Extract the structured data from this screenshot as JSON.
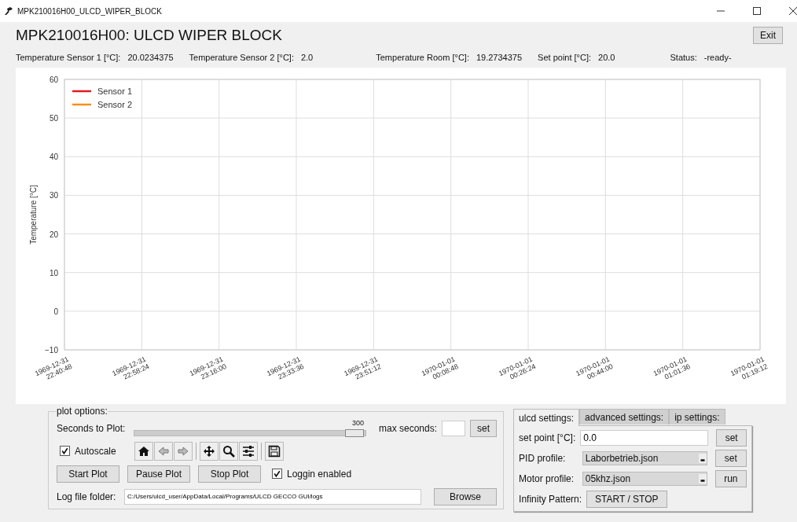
{
  "window": {
    "title": "MPK210016H00_ULCD_WIPER_BLOCK"
  },
  "header": {
    "title": "MPK210016H00: ULCD WIPER BLOCK",
    "exit_button": "Exit"
  },
  "readings": [
    {
      "label": "Temperature Sensor 1 [°C]:",
      "value": "20.0234375"
    },
    {
      "label": "Temperature Sensor 2 [°C]:",
      "value": "2.0"
    },
    {
      "label": "Temperature Room [°C]:",
      "value": "19.2734375"
    },
    {
      "label": "Set point [°C]:",
      "value": "20.0"
    },
    {
      "label": "Status:",
      "value": "-ready-"
    }
  ],
  "chart": {
    "chart_data": {
      "type": "line",
      "grid": true,
      "ylabel": "Temperature [°C]",
      "ylim": [
        -10,
        60
      ],
      "yticks": [
        {
          "value": -10,
          "label": "−10"
        },
        0,
        10,
        20,
        30,
        40,
        50,
        60
      ],
      "categories": [
        "1969-12-31 22:40:48",
        "1969-12-31 22:58:24",
        "1969-12-31 23:16:00",
        "1969-12-31 23:33:36",
        "1969-12-31 23:51:12",
        "1970-01-01 00:08:48",
        "1970-01-01 00:26:24",
        "1970-01-01 00:44:00",
        "1970-01-01 01:01:36",
        "1970-01-01 01:19:12"
      ],
      "series": [
        {
          "name": "Sensor 1",
          "color": "#e31a1c",
          "values": [
            null,
            null,
            null,
            null,
            null,
            null,
            null,
            null,
            null,
            null
          ]
        },
        {
          "name": "Sensor 2",
          "color": "#ff8c1a",
          "values": [
            null,
            null,
            null,
            null,
            null,
            null,
            null,
            null,
            null,
            null
          ]
        }
      ]
    }
  },
  "plot_options": {
    "title": "plot options:",
    "seconds_label": "Seconds to Plot:",
    "slider": {
      "level": 1.0,
      "reading": "300"
    },
    "max_seconds_label": "max seconds:",
    "set_button": "set",
    "autoscale": {
      "label": "Autoscale",
      "checked": true
    },
    "buttons": [
      "Start Plot",
      "Pause Plot",
      "Stop Plot"
    ],
    "logging": {
      "label": "Loggin enabled",
      "checked": true
    },
    "log_folder_label": "Log file folder:",
    "log_folder_value": "C:/Users/ulcd_user/AppData/Local/Programs/ULCD GECCO GUI/logs",
    "browse_button": "Browse"
  },
  "settings": {
    "tabs": [
      {
        "label": "ulcd settings:",
        "selected": true
      },
      {
        "label": "advanced settings:",
        "selected": false
      },
      {
        "label": "ip settings:",
        "selected": false
      }
    ],
    "rows": [
      {
        "kind": "input",
        "label": "set point [°C]:",
        "value": "0.0",
        "button": "set"
      },
      {
        "kind": "select",
        "label": "PID profile:",
        "value": "Laborbetrieb.json",
        "button": "set"
      },
      {
        "kind": "select",
        "label": "Motor profile:",
        "value": "05khz.json",
        "button": "run"
      },
      {
        "kind": "button",
        "label": "Infinity Pattern:",
        "button": "START / STOP"
      }
    ]
  }
}
